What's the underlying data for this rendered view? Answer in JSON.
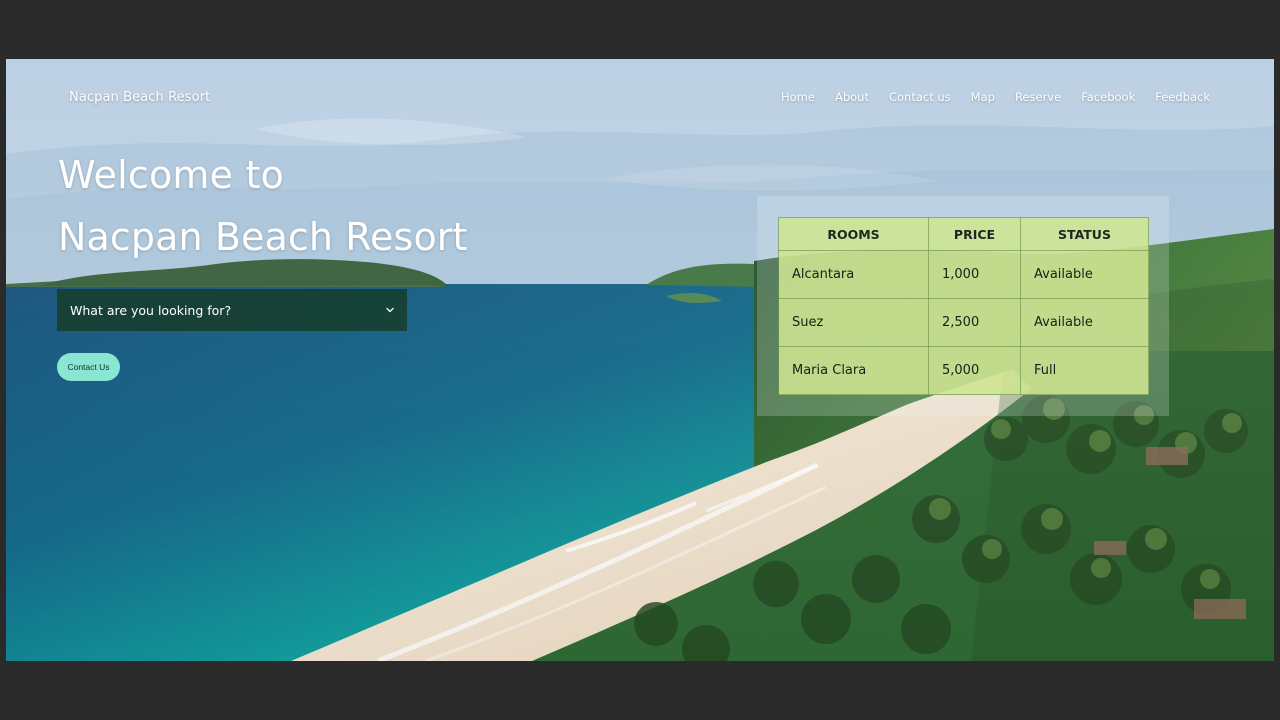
{
  "brand": {
    "title": "Nacpan Beach Resort"
  },
  "nav": {
    "items": [
      {
        "label": "Home"
      },
      {
        "label": "About"
      },
      {
        "label": "Contact us"
      },
      {
        "label": "Map"
      },
      {
        "label": "Reserve"
      },
      {
        "label": "Facebook"
      },
      {
        "label": "Feedback"
      }
    ]
  },
  "hero": {
    "welcome_line_1": "Welcome to",
    "welcome_line_2": "Nacpan Beach Resort"
  },
  "search": {
    "selected_value": "What are you looking for?"
  },
  "actions": {
    "contact_button": "Contact Us"
  },
  "table": {
    "headers": [
      "ROOMS",
      "PRICE",
      "STATUS"
    ],
    "rows": [
      [
        "Alcantara",
        "1,000",
        "Available"
      ],
      [
        "Suez",
        "2,500",
        "Available"
      ],
      [
        "Maria Clara",
        "5,000",
        "Full"
      ]
    ]
  },
  "icons": {
    "dropdown": "chevron-down-icon"
  },
  "colors": {
    "page_background": "#2a2a2a",
    "accent_button": "#89e6d2",
    "select_background": "#163d2a",
    "table_fill": "#cee591"
  }
}
